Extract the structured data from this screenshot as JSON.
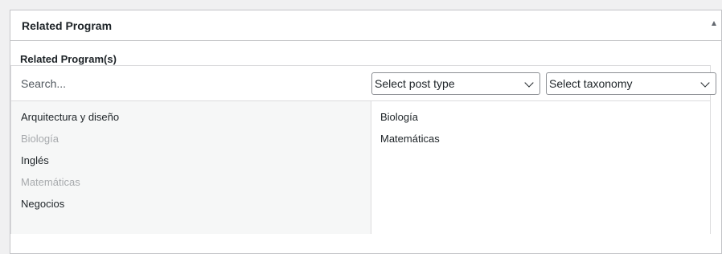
{
  "metabox": {
    "title": "Related Program",
    "field_label": "Related Program(s)"
  },
  "filters": {
    "search_placeholder": "Search...",
    "post_type_select": "Select post type",
    "taxonomy_select": "Select taxonomy"
  },
  "choices": [
    {
      "label": "Arquitectura y diseño",
      "disabled": false
    },
    {
      "label": "Biología",
      "disabled": true
    },
    {
      "label": "Inglés",
      "disabled": false
    },
    {
      "label": "Matemáticas",
      "disabled": true
    },
    {
      "label": "Negocios",
      "disabled": false
    }
  ],
  "selections": [
    {
      "label": "Biología"
    },
    {
      "label": "Matemáticas"
    }
  ],
  "colors": {
    "border": "#c3c4c7",
    "choices_bg": "#f6f7f7",
    "disabled_text": "#a7aaad",
    "text": "#1d2327"
  }
}
